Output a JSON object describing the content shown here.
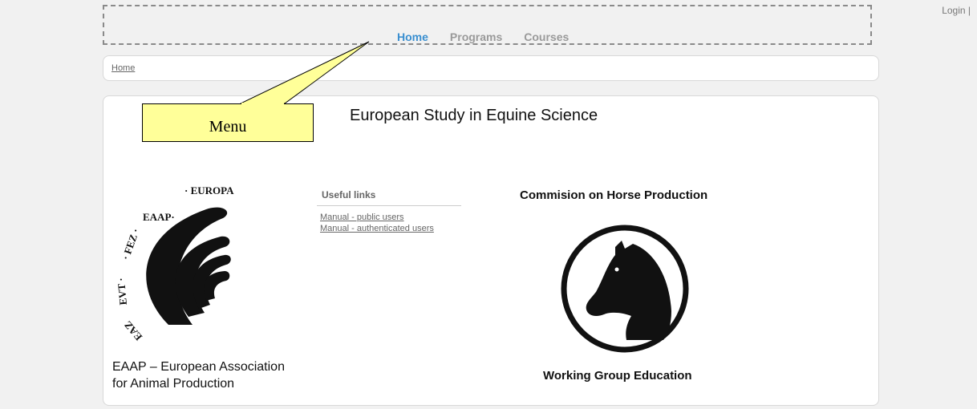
{
  "header": {
    "login_label": "Login |"
  },
  "nav": {
    "items": [
      {
        "label": "Home"
      },
      {
        "label": "Programs"
      },
      {
        "label": "Courses"
      }
    ]
  },
  "breadcrumb": {
    "home_label": "Home"
  },
  "annotation": {
    "label": "Menu"
  },
  "main": {
    "title": "European Study in Equine Science",
    "useful_links": {
      "heading": "Useful links",
      "links": [
        {
          "label": "Manual - public users"
        },
        {
          "label": "Manual - authenticated users"
        }
      ]
    },
    "eaap": {
      "line1": "EAAP – European Association",
      "line2": "for Animal Production",
      "logo_text": "EAAP · EUROPA · FEZ · EVT · EAZ"
    },
    "commision_title": "Commision on Horse Production",
    "working_group": "Working Group Education"
  }
}
